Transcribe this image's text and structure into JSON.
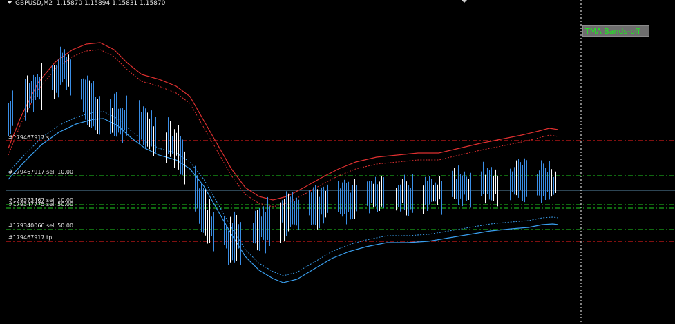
{
  "header": {
    "symbol": "GBPUSD,M2",
    "quote": "1.15870 1.15894 1.15831 1.15870"
  },
  "orders": [
    {
      "label": "#179467917 sl",
      "color": "#ff2020",
      "style": "dashdot"
    },
    {
      "label": "#179467917 sell 10.00",
      "color": "#20d020",
      "style": "dashdot"
    },
    {
      "label": "#179373467 sell 10.00",
      "color": "#20d020",
      "style": "dashdot"
    },
    {
      "label": "#179347775 sell 50.00",
      "color": "#20d020",
      "style": "dashdot"
    },
    {
      "label": "#179340066 sell 50.00",
      "color": "#20d020",
      "style": "dashdot"
    },
    {
      "label": "#179467917 tp",
      "color": "#ff2020",
      "style": "dashdot"
    }
  ],
  "indicator_button": {
    "label": "TMA Bands-off",
    "text_color": "#22e622"
  },
  "colors": {
    "background": "#000000",
    "bar": "#3a8ee6",
    "bar_light": "#ffffff",
    "upper_band": "#e03030",
    "lower_band": "#3aa0f0",
    "bid_line": "#5a8aa8",
    "last_bar": "#20d020",
    "separator": "#ffffff"
  }
}
